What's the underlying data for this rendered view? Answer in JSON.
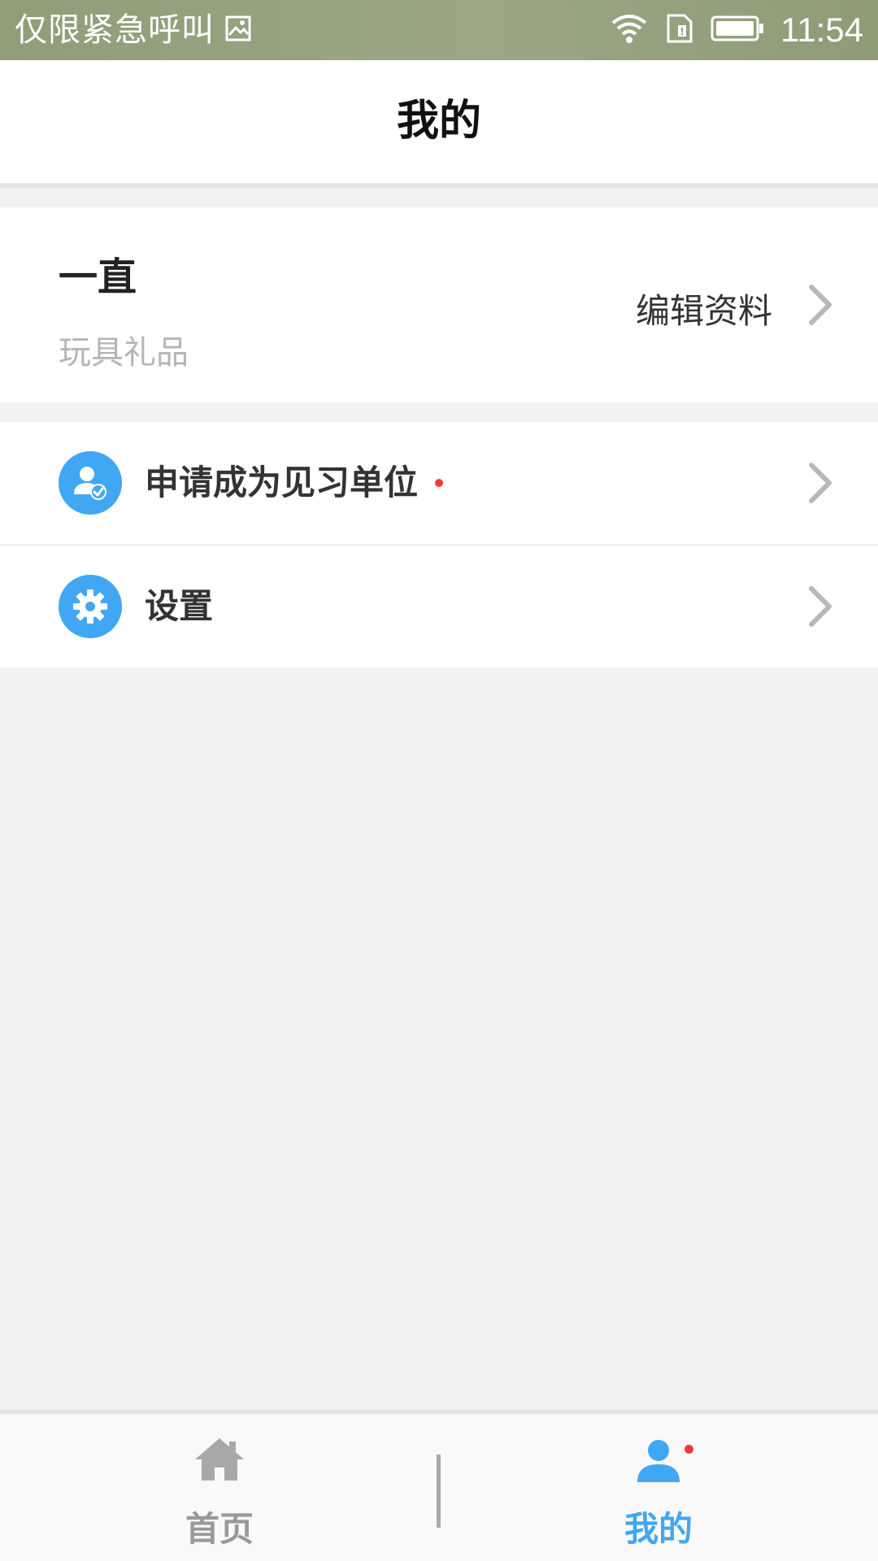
{
  "status_bar": {
    "carrier_text": "仅限紧急呼叫",
    "time": "11:54",
    "icons": [
      "image-icon",
      "wifi-icon",
      "sim-icon",
      "battery-icon"
    ]
  },
  "header": {
    "title": "我的"
  },
  "profile": {
    "name": "一直",
    "subtitle": "玩具礼品",
    "edit_label": "编辑资料"
  },
  "menu": {
    "items": [
      {
        "label": "申请成为见习单位",
        "icon": "user-check-icon",
        "has_badge": true
      },
      {
        "label": "设置",
        "icon": "gear-icon",
        "has_badge": false
      }
    ]
  },
  "tab_bar": {
    "tabs": [
      {
        "label": "首页",
        "icon": "home-icon",
        "active": false
      },
      {
        "label": "我的",
        "icon": "user-icon",
        "active": true,
        "has_badge": true
      }
    ]
  },
  "colors": {
    "accent": "#41a7f5",
    "badge": "#f23a3a",
    "inactive": "#999999",
    "background": "#f2f2f2"
  }
}
